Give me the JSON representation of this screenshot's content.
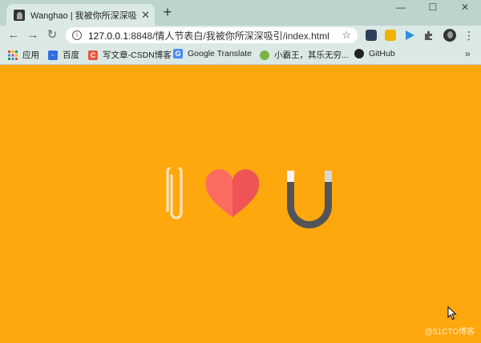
{
  "browser": {
    "tab": {
      "title": "Wanghao | 我被你所深深吸引|",
      "close": "✕"
    },
    "new_tab": "+",
    "window_controls": {
      "minimize": "—",
      "maximize": "☐",
      "close": "✕"
    },
    "nav": {
      "back": "←",
      "forward": "→",
      "reload": "↻"
    },
    "address": {
      "host": "127.0.0.1",
      "rest": ":8848/情人节表白/我被你所深深吸引/index.html"
    },
    "bookmarks": [
      {
        "label": "应用",
        "icon": "apps-grid-icon"
      },
      {
        "label": "百度",
        "icon": "baidu-paw-icon"
      },
      {
        "label": "写文章-CSDN博客",
        "icon": "csdn-c-icon"
      },
      {
        "label": "Google Translate",
        "icon": "google-translate-icon"
      },
      {
        "label": "小霸王，其乐无穷...",
        "icon": "game-icon"
      },
      {
        "label": "GitHub",
        "icon": "github-icon"
      }
    ],
    "bookmarks_more": "»"
  },
  "page": {
    "background": "#ffa80e",
    "icons": [
      "paperclip-icon",
      "heart-icon",
      "magnet-icon"
    ],
    "watermark": "@51CTO博客"
  }
}
